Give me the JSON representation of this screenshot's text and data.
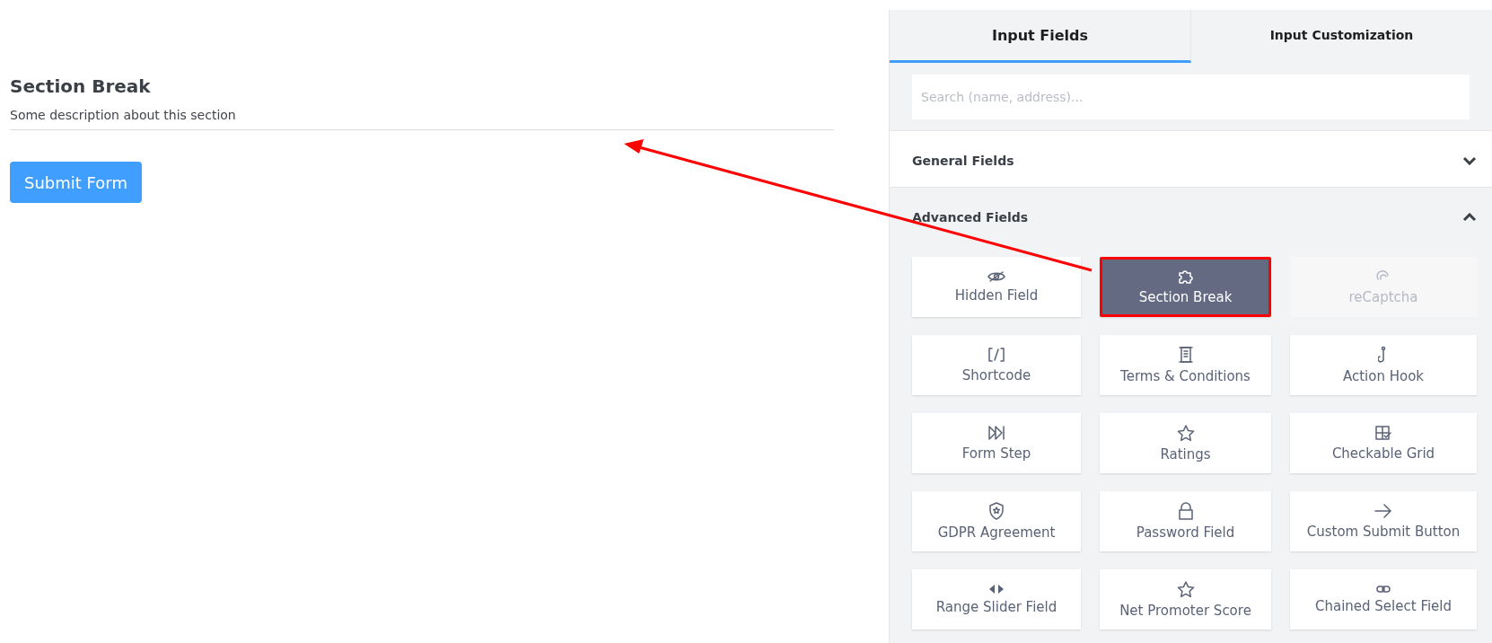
{
  "form": {
    "section_title": "Section Break",
    "section_description": "Some description about this section",
    "submit_button": "Submit Form"
  },
  "panel": {
    "tabs": [
      {
        "label": "Input Fields",
        "selected": true
      },
      {
        "label": "Input Customization",
        "selected": false
      }
    ],
    "search": {
      "placeholder": "Search (name, address)..."
    },
    "groups": [
      {
        "title": "General Fields",
        "expanded": false
      },
      {
        "title": "Advanced Fields",
        "expanded": true,
        "items": [
          {
            "label": "Hidden Field",
            "selected": false,
            "disabled": false
          },
          {
            "label": "Section Break",
            "selected": true,
            "disabled": false
          },
          {
            "label": "reCaptcha",
            "selected": false,
            "disabled": true
          },
          {
            "label": "Shortcode",
            "selected": false,
            "disabled": false
          },
          {
            "label": "Terms & Conditions",
            "selected": false,
            "disabled": false
          },
          {
            "label": "Action Hook",
            "selected": false,
            "disabled": false
          },
          {
            "label": "Form Step",
            "selected": false,
            "disabled": false
          },
          {
            "label": "Ratings",
            "selected": false,
            "disabled": false
          },
          {
            "label": "Checkable Grid",
            "selected": false,
            "disabled": false
          },
          {
            "label": "GDPR Agreement",
            "selected": false,
            "disabled": false
          },
          {
            "label": "Password Field",
            "selected": false,
            "disabled": false
          },
          {
            "label": "Custom Submit Button",
            "selected": false,
            "disabled": false
          },
          {
            "label": "Range Slider Field",
            "selected": false,
            "disabled": false
          },
          {
            "label": "Net Promoter Score",
            "selected": false,
            "disabled": false
          },
          {
            "label": "Chained Select Field",
            "selected": false,
            "disabled": false
          }
        ]
      }
    ]
  }
}
